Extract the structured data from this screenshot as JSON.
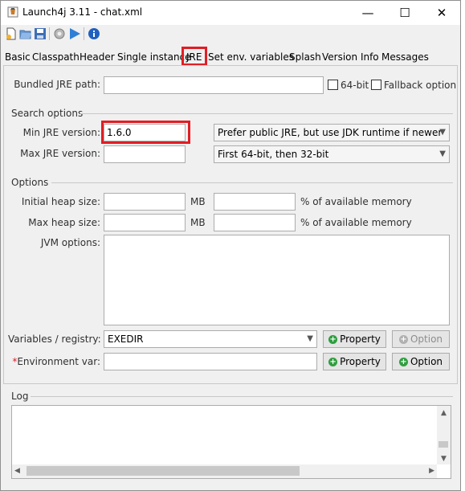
{
  "window": {
    "title": "Launch4j 3.11 - chat.xml",
    "minimize": "—",
    "maximize": "☐",
    "close": "✕"
  },
  "toolbar": {
    "icons": [
      "new-icon",
      "open-icon",
      "save-icon",
      "settings-icon",
      "run-icon",
      "info-icon"
    ]
  },
  "tabs": [
    {
      "label": "Basic"
    },
    {
      "label": "Classpath"
    },
    {
      "label": "Header"
    },
    {
      "label": "Single instance"
    },
    {
      "label": "JRE"
    },
    {
      "label": "Set env. variables"
    },
    {
      "label": "Splash"
    },
    {
      "label": "Version Info"
    },
    {
      "label": "Messages"
    }
  ],
  "jre": {
    "bundled_label": "Bundled JRE path:",
    "bundled_value": "",
    "bit64_label": "64-bit",
    "fallback_label": "Fallback option"
  },
  "search": {
    "group": "Search options",
    "min_label": "Min JRE version:",
    "min_value": "1.6.0",
    "max_label": "Max JRE version:",
    "max_value": "",
    "jdk_pref": "Prefer public JRE, but use JDK runtime if newer",
    "arch_pref": "First 64-bit, then 32-bit"
  },
  "options": {
    "group": "Options",
    "init_heap_label": "Initial heap size:",
    "max_heap_label": "Max heap size:",
    "mb": "MB",
    "pct": "% of available memory",
    "jvm_label": "JVM options:",
    "vars_label": "Variables / registry:",
    "vars_value": "EXEDIR",
    "property_btn": "Property",
    "option_btn": "Option",
    "env_star": "*",
    "env_label": "Environment var:"
  },
  "log": {
    "label": "Log"
  },
  "colors": {
    "highlight": "#e01e24",
    "accent": "#2e9e3f"
  }
}
